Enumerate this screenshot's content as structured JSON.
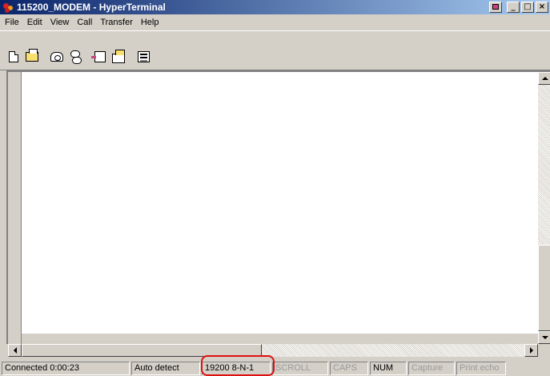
{
  "window": {
    "title": "115200_MODEM - HyperTerminal",
    "controls": [
      "_",
      "□",
      "×"
    ]
  },
  "menu": [
    "File",
    "Edit",
    "View",
    "Call",
    "Transfer",
    "Help"
  ],
  "toolbar": {
    "icons": [
      "new-connection-icon",
      "open-icon",
      "call-icon",
      "disconnect-icon",
      "send-icon",
      "receive-icon",
      "properties-icon"
    ]
  },
  "terminal": {
    "text": ""
  },
  "status": {
    "connected": "Connected 0:00:23",
    "detect": "Auto detect",
    "port_settings": "19200 8-N-1",
    "scroll": "SCROLL",
    "caps": "CAPS",
    "num": "NUM",
    "capture": "Capture",
    "print_echo": "Print echo"
  },
  "colors": {
    "highlight": "#e01010",
    "titlebar_start": "#0a246a",
    "titlebar_end": "#a6caf0"
  }
}
